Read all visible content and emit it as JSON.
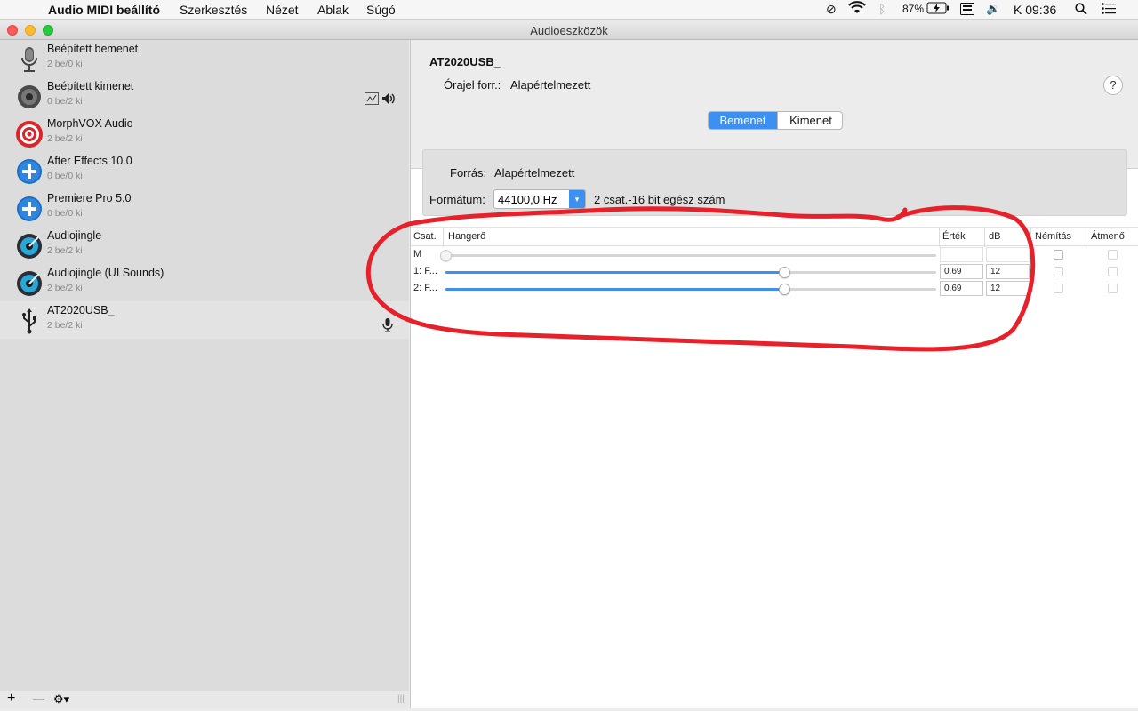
{
  "menubar": {
    "app_name": "Audio MIDI beállító",
    "items": [
      "Szerkesztés",
      "Nézet",
      "Ablak",
      "Súgó"
    ],
    "battery": "87%",
    "clock": "K 09:36"
  },
  "window": {
    "title": "Audioeszközök"
  },
  "devices": [
    {
      "name": "Beépített bemenet",
      "io": "2 be/0 ki",
      "icon": "microphone-icon"
    },
    {
      "name": "Beépített kimenet",
      "io": "0 be/2 ki",
      "icon": "speaker-icon"
    },
    {
      "name": "MorphVOX Audio",
      "io": "2 be/2 ki",
      "icon": "target-icon"
    },
    {
      "name": "After Effects 10.0",
      "io": "0 be/0 ki",
      "icon": "plus-icon"
    },
    {
      "name": "Premiere Pro 5.0",
      "io": "0 be/0 ki",
      "icon": "plus-icon"
    },
    {
      "name": "Audiojingle",
      "io": "2 be/2 ki",
      "icon": "audiojingle-icon"
    },
    {
      "name": "Audiojingle (UI Sounds)",
      "io": "2 be/2 ki",
      "icon": "audiojingle-icon"
    },
    {
      "name": "AT2020USB_",
      "io": "2 be/2 ki",
      "icon": "usb-icon"
    }
  ],
  "selected_device": "AT2020USB_",
  "detail": {
    "device_title": "AT2020USB_",
    "clock_label": "Órajel forr.:",
    "clock_value": "Alapértelmezett",
    "help": "?",
    "tabs": [
      "Bemenet",
      "Kimenet"
    ],
    "active_tab": "Bemenet",
    "source_label": "Forrás:",
    "source_value": "Alapértelmezett",
    "format_label": "Formátum:",
    "format_value": "44100,0 Hz",
    "format_desc": "2 csat.-16 bit egész szám"
  },
  "table": {
    "headers": {
      "channel": "Csat.",
      "volume": "Hangerő",
      "value": "Érték",
      "db": "dB",
      "mute": "Némítás",
      "thru": "Átmenő"
    },
    "rows": [
      {
        "channel": "M",
        "volume": 0,
        "value": "",
        "db": "",
        "mute_enabled": true
      },
      {
        "channel": "1: F...",
        "volume": 0.69,
        "value": "0.69",
        "db": "12",
        "mute_enabled": false
      },
      {
        "channel": "2: F...",
        "volume": 0.69,
        "value": "0.69",
        "db": "12",
        "mute_enabled": false
      }
    ]
  },
  "bottombar": {
    "add": "+",
    "remove": "—",
    "gear": "⚙▾"
  },
  "colors": {
    "accent": "#3d8ff1",
    "annotation": "#e8202a"
  }
}
